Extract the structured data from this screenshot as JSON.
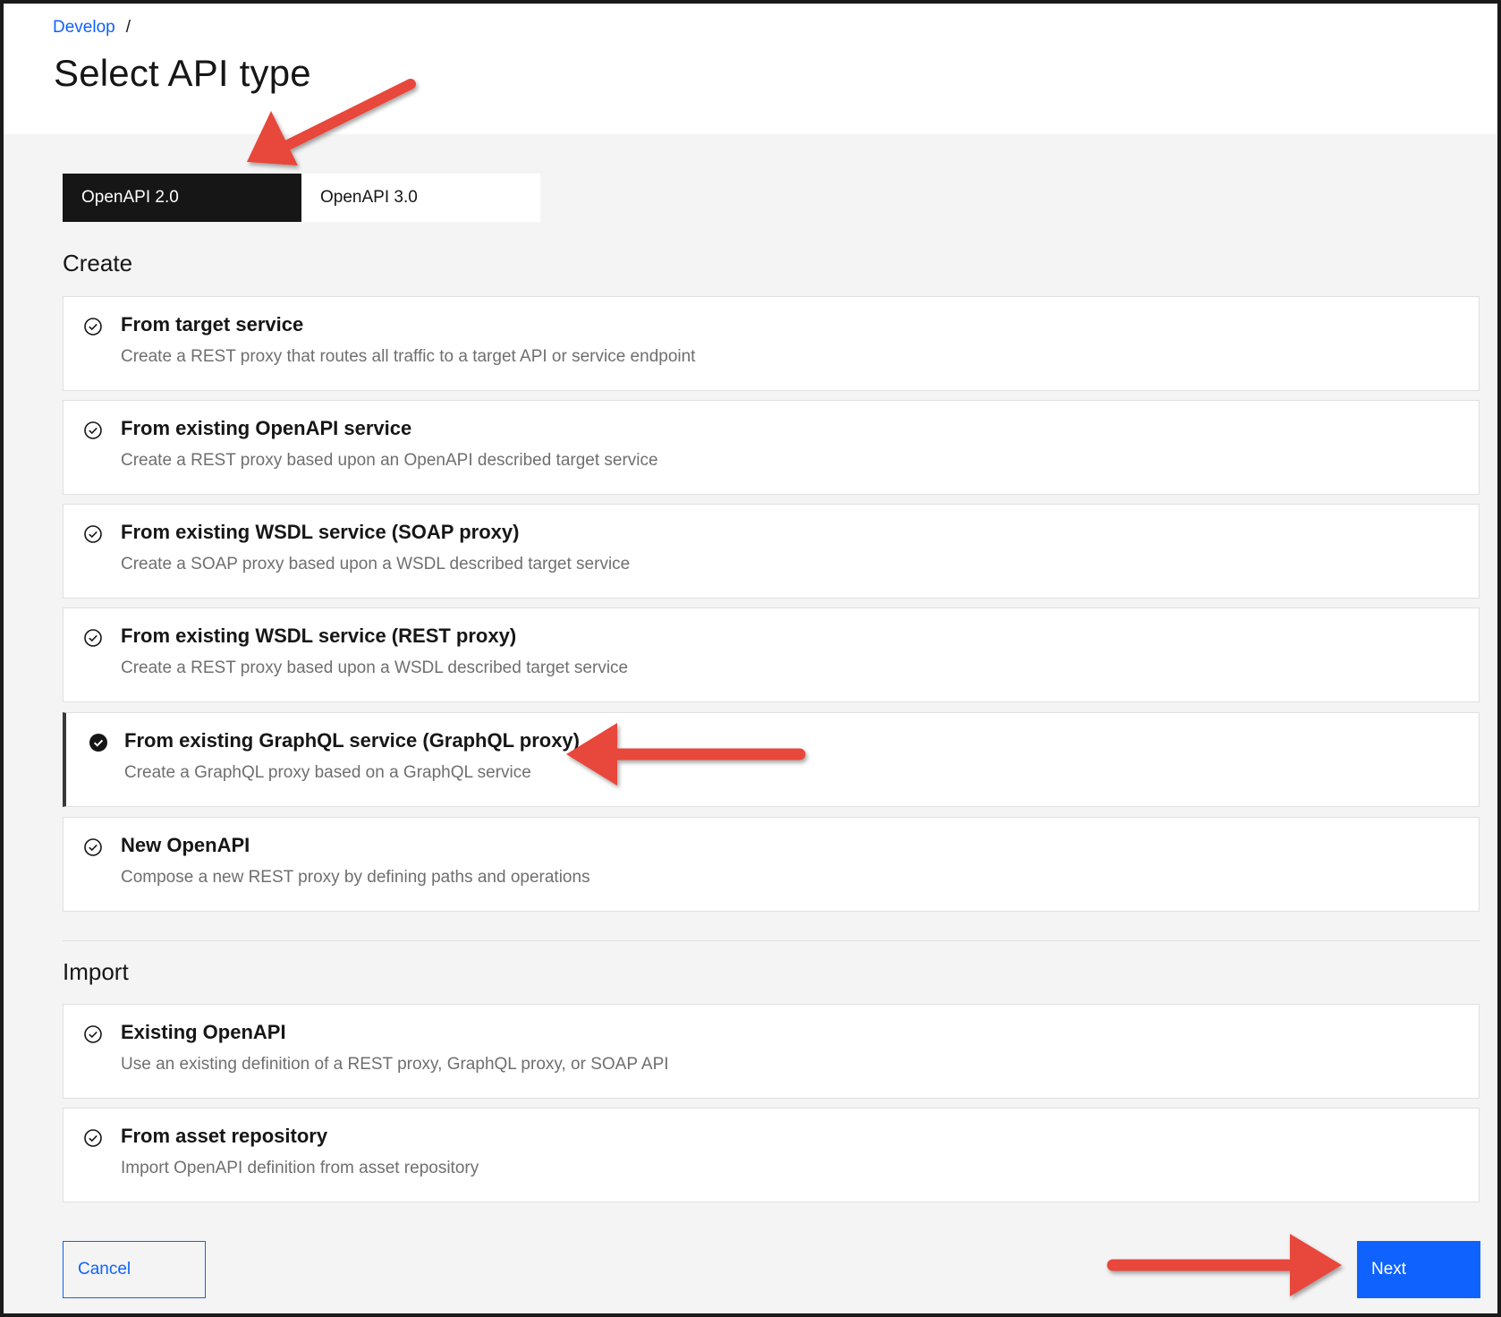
{
  "breadcrumb": {
    "link": "Develop",
    "separator": "/"
  },
  "page_title": "Select API type",
  "tabs": [
    {
      "label": "OpenAPI 2.0",
      "active": true
    },
    {
      "label": "OpenAPI 3.0",
      "active": false
    }
  ],
  "create": {
    "heading": "Create",
    "items": [
      {
        "title": "From target service",
        "desc": "Create a REST proxy that routes all traffic to a target API or service endpoint",
        "selected": false
      },
      {
        "title": "From existing OpenAPI service",
        "desc": "Create a REST proxy based upon an OpenAPI described target service",
        "selected": false
      },
      {
        "title": "From existing WSDL service (SOAP proxy)",
        "desc": "Create a SOAP proxy based upon a WSDL described target service",
        "selected": false
      },
      {
        "title": "From existing WSDL service (REST proxy)",
        "desc": "Create a REST proxy based upon a WSDL described target service",
        "selected": false
      },
      {
        "title": "From existing GraphQL service (GraphQL proxy)",
        "desc": "Create a GraphQL proxy based on a GraphQL service",
        "selected": true
      },
      {
        "title": "New OpenAPI",
        "desc": "Compose a new REST proxy by defining paths and operations",
        "selected": false
      }
    ]
  },
  "import": {
    "heading": "Import",
    "items": [
      {
        "title": "Existing OpenAPI",
        "desc": "Use an existing definition of a REST proxy, GraphQL proxy, or SOAP API",
        "selected": false
      },
      {
        "title": "From asset repository",
        "desc": "Import OpenAPI definition from asset repository",
        "selected": false
      }
    ]
  },
  "buttons": {
    "cancel": "Cancel",
    "next": "Next"
  },
  "colors": {
    "accent": "#0f62fe",
    "annotation_arrow": "#e8473b",
    "selected_tab": "#161616"
  },
  "icons": {
    "unselected": "checkmark-outline-icon",
    "selected": "checkmark-filled-icon"
  }
}
